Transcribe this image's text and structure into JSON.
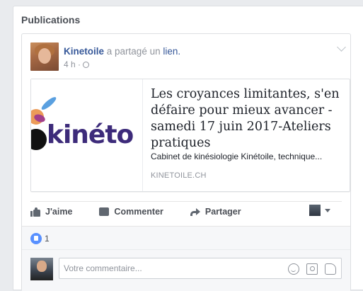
{
  "panel": {
    "title": "Publications"
  },
  "post": {
    "author": "Kinetoile",
    "action_prefix": "a partagé un",
    "action_link": "lien.",
    "time": "4 h ·"
  },
  "link_card": {
    "title": "Les croyances limitantes, s'en défaire pour mieux avancer - samedi 17 juin 2017-Ateliers pratiques",
    "description": "Cabinet de kinésiologie Kinétoile, technique...",
    "domain": "KINETOILE.CH",
    "image_logo_text": "kinéto"
  },
  "actions": {
    "like": "J'aime",
    "comment": "Commenter",
    "share": "Partager"
  },
  "reactions": {
    "count": "1"
  },
  "comment_box": {
    "placeholder": "Votre commentaire..."
  },
  "colors": {
    "link_blue": "#365899",
    "meta_gray": "#90949c",
    "like_blue": "#5890ff"
  },
  "icons": [
    "globe-icon",
    "chevron-down-icon",
    "like-icon",
    "comment-icon",
    "share-icon",
    "caret-down-icon",
    "like-reaction-icon",
    "smiley-icon",
    "camera-icon",
    "sticker-icon"
  ]
}
